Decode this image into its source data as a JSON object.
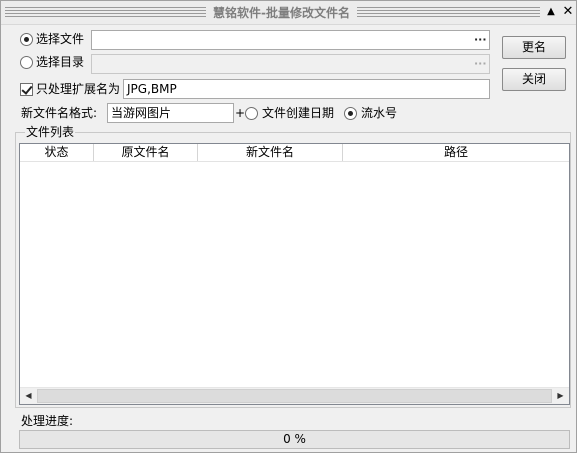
{
  "window": {
    "title": "慧铭软件-批量修改文件名",
    "minimize_glyph": "▲",
    "close_glyph": "✕"
  },
  "source": {
    "select_file_label": "选择文件",
    "select_file_selected": true,
    "select_file_value": "",
    "select_dir_label": "选择目录",
    "select_dir_selected": false,
    "select_dir_value": "",
    "browse_glyph": "···"
  },
  "filter": {
    "checked": true,
    "label": "只处理扩展名为",
    "value": "JPG,BMP"
  },
  "format": {
    "label": "新文件名格式:",
    "prefix_value": "当游网图片",
    "plus": "+",
    "option_date_label": "文件创建日期",
    "option_date_selected": false,
    "option_serial_label": "流水号",
    "option_serial_selected": true
  },
  "buttons": {
    "rename": "更名",
    "close": "关闭"
  },
  "file_list": {
    "legend": "文件列表",
    "columns": [
      "状态",
      "原文件名",
      "新文件名",
      "路径"
    ],
    "rows": []
  },
  "scrollbar": {
    "left_arrow": "◀",
    "right_arrow": "▶"
  },
  "progress": {
    "label": "处理进度:",
    "text": "0 %",
    "value": 0
  }
}
